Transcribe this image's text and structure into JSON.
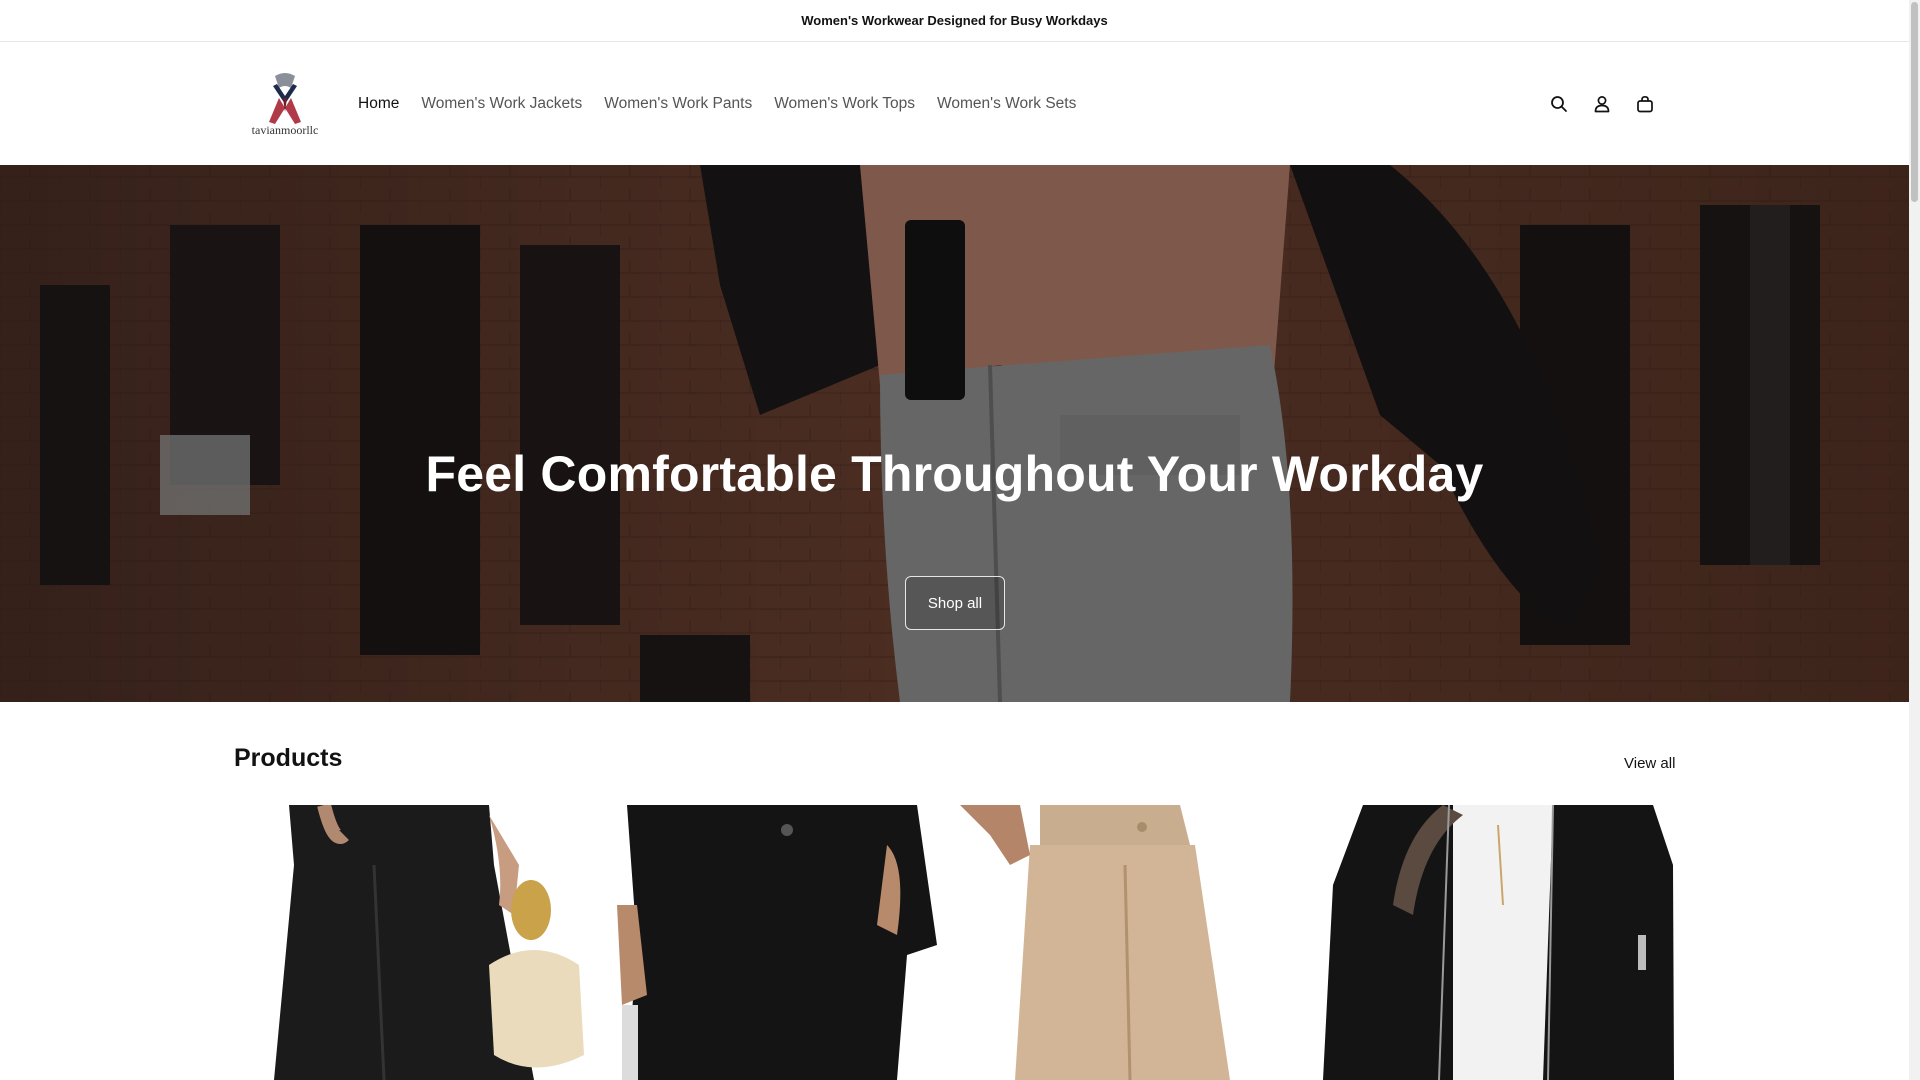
{
  "announcement": {
    "text": "Women's Workwear Designed for Busy Workdays"
  },
  "header": {
    "logo_text": "tavianmoorllc",
    "nav": [
      {
        "label": "Home",
        "active": true
      },
      {
        "label": "Women's Work Jackets",
        "active": false
      },
      {
        "label": "Women's Work Pants",
        "active": false
      },
      {
        "label": "Women's Work Tops",
        "active": false
      },
      {
        "label": "Women's Work Sets",
        "active": false
      }
    ],
    "icons": [
      "search-icon",
      "account-icon",
      "cart-icon"
    ]
  },
  "hero": {
    "title": "Feel Comfortable Throughout Your Workday",
    "button_label": "Shop all"
  },
  "products": {
    "title": "Products",
    "view_all_label": "View all",
    "items": [
      {
        "image": "black-wide-leg-pants-with-handbag"
      },
      {
        "image": "black-blouse-and-pants-set"
      },
      {
        "image": "beige-vest-and-pants-set"
      },
      {
        "image": "black-bomber-jacket"
      }
    ]
  },
  "colors": {
    "text": "#121212",
    "nav_muted": "#555555",
    "border": "#e6e6e6",
    "hero_overlay": "#000000"
  }
}
